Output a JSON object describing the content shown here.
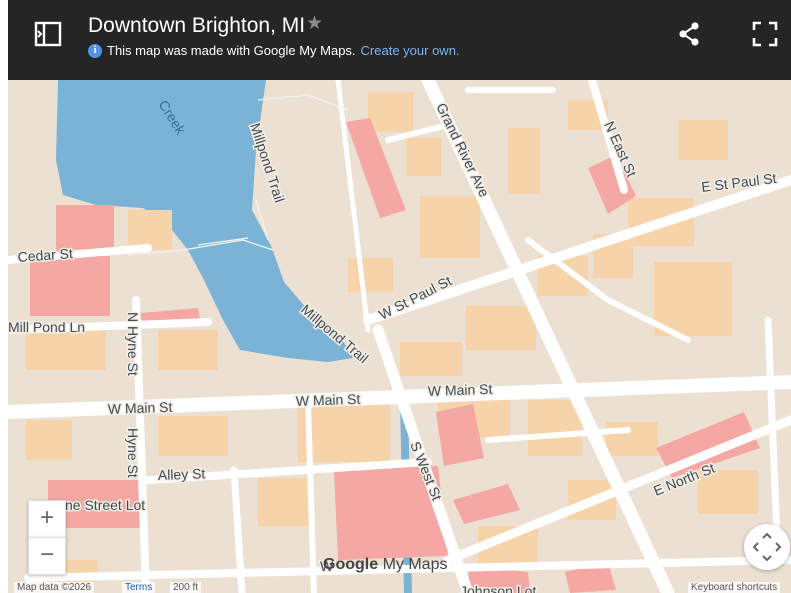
{
  "header": {
    "title": "Downtown Brighton, MI",
    "info_text": "This map was made with Google My Maps.",
    "create_link": "Create your own."
  },
  "map": {
    "labels": {
      "creek": "Creek",
      "millpond_trail_1": "Millpond Trail",
      "millpond_trail_2": "Millpond Trail",
      "grand_river": "Grand River Ave",
      "n_east": "N East St",
      "e_st_paul": "E St Paul St",
      "cedar": "Cedar St",
      "w_st_paul": "W St Paul St",
      "mill_pond": "Mill Pond Ln",
      "n_hyne": "N Hyne St",
      "w_main_left": "W Main St",
      "w_main_mid": "W Main St",
      "w_main_right": "W Main St",
      "hyne": "Hyne St",
      "s_west": "S West St",
      "alley": "Alley St",
      "e_north": "E North St",
      "street_lot": "yne Street Lot",
      "johnson_lot": "Johnson Lot",
      "w_partial": "W"
    },
    "colors": {
      "land": "#ece0d3",
      "building": "#f6d3a8",
      "parking": "#f4a7a3",
      "water": "#7ab3d5",
      "road": "#ffffff"
    }
  },
  "controls": {
    "zoom_in": "+",
    "zoom_out": "−"
  },
  "watermark": {
    "google": "Google",
    "my_maps": "My Maps"
  },
  "footer": {
    "map_data": "Map data ©2026",
    "terms": "Terms",
    "scale": "200 ft",
    "shortcuts": "Keyboard shortcuts"
  }
}
